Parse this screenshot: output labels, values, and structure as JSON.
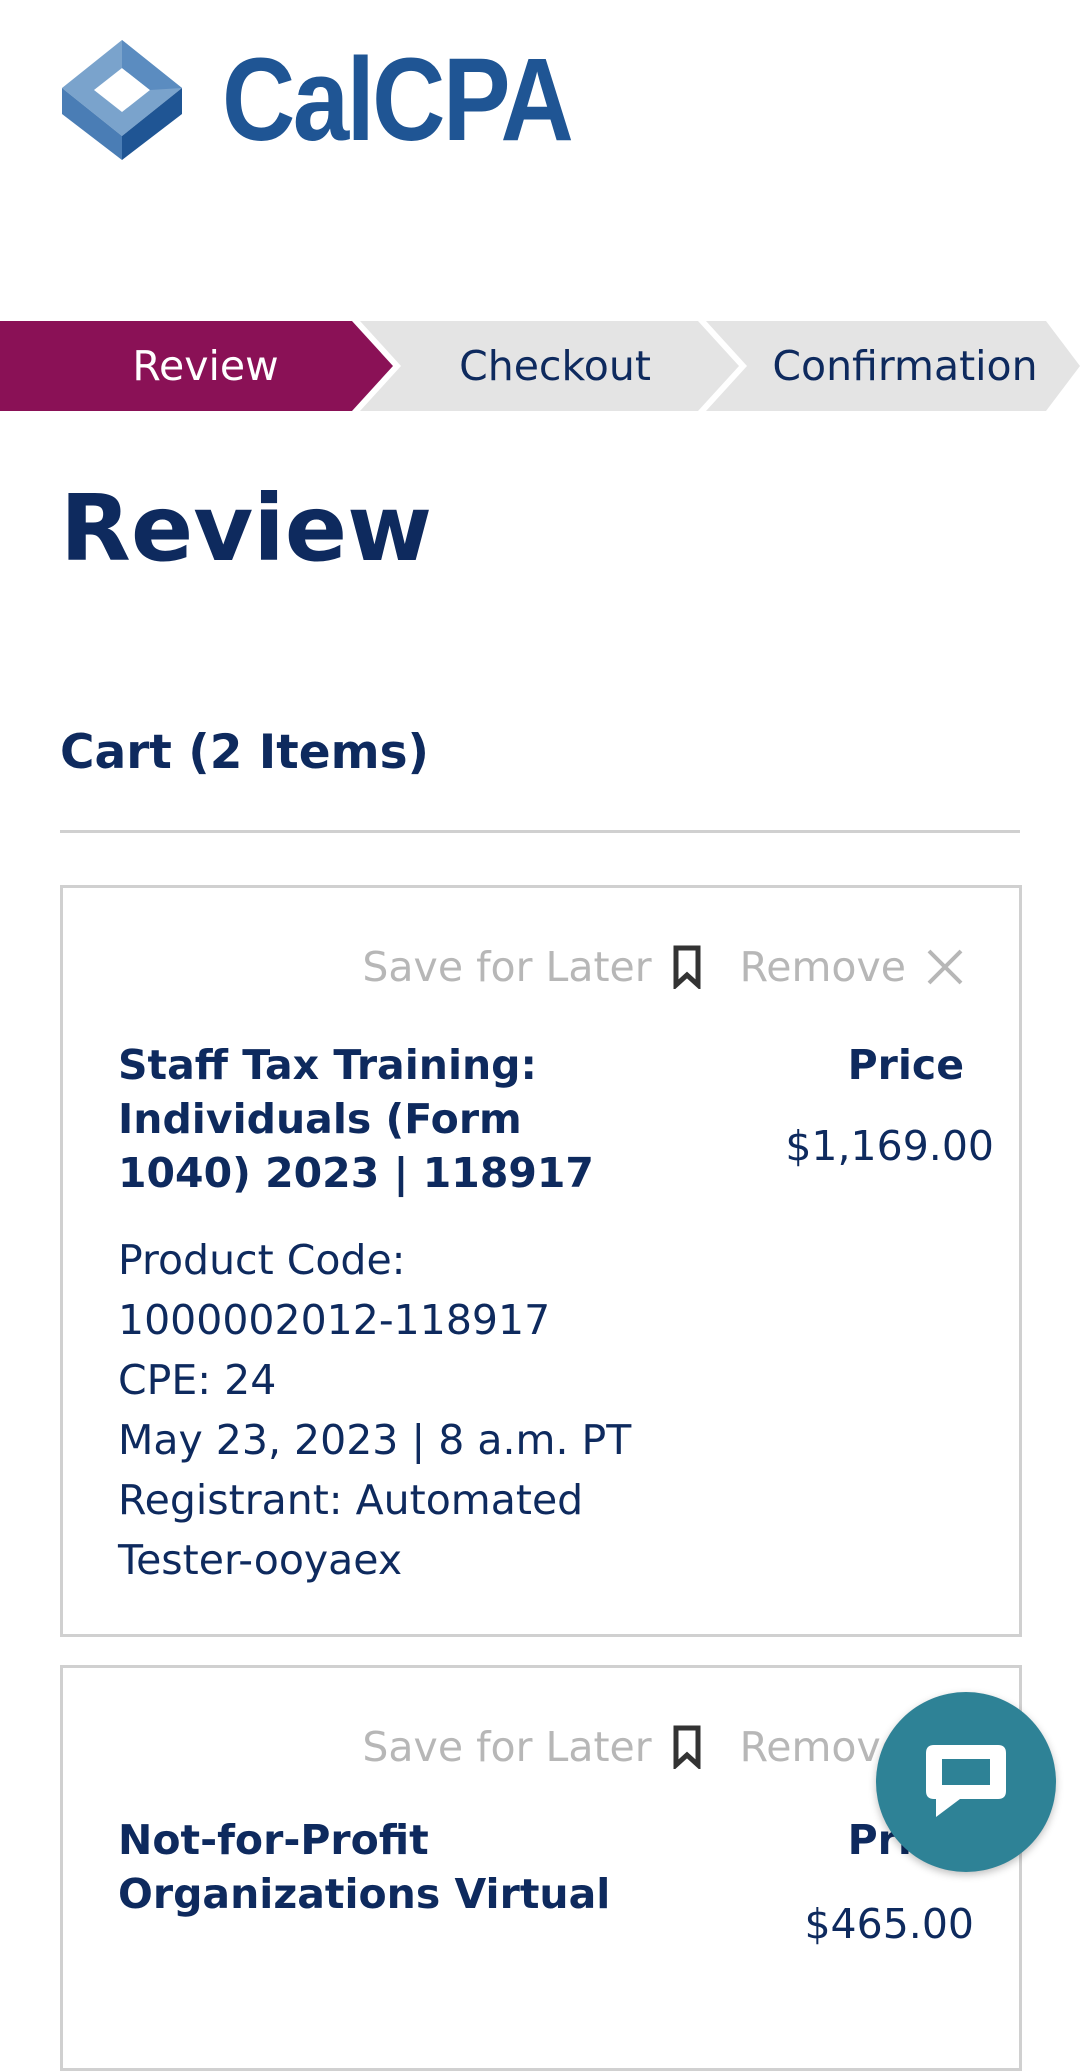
{
  "brand": {
    "name": "CalCPA"
  },
  "steps": [
    {
      "label": "Review",
      "active": true
    },
    {
      "label": "Checkout",
      "active": false
    },
    {
      "label": "Confirmation",
      "active": false
    }
  ],
  "page_title": "Review",
  "cart": {
    "heading": "Cart (2 Items)",
    "items": [
      {
        "save_label": "Save for Later",
        "remove_label": "Remove",
        "title": "Staff Tax Training: Individuals (Form 1040) 2023 | 118917",
        "price_label": "Price",
        "price": "$1,169.00",
        "details": [
          "Product Code: 1000002012-118917",
          "CPE: 24",
          "May 23, 2023 | 8 a.m. PT",
          "Registrant: Automated Tester-ooyaex"
        ]
      },
      {
        "save_label": "Save for Later",
        "remove_label": "Remove",
        "title": "Not-for-Profit Organizations Virtual",
        "price_label": "Price",
        "price": "$465.00"
      }
    ]
  },
  "colors": {
    "accent": "#8a1156",
    "navy": "#0e2a5e",
    "step_inactive": "#e4e4e4",
    "chat": "#2e8296",
    "logo": "#1f5594"
  },
  "icons": {
    "save": "bookmark-icon",
    "remove": "close-icon",
    "chat": "chat-bubble-icon"
  }
}
